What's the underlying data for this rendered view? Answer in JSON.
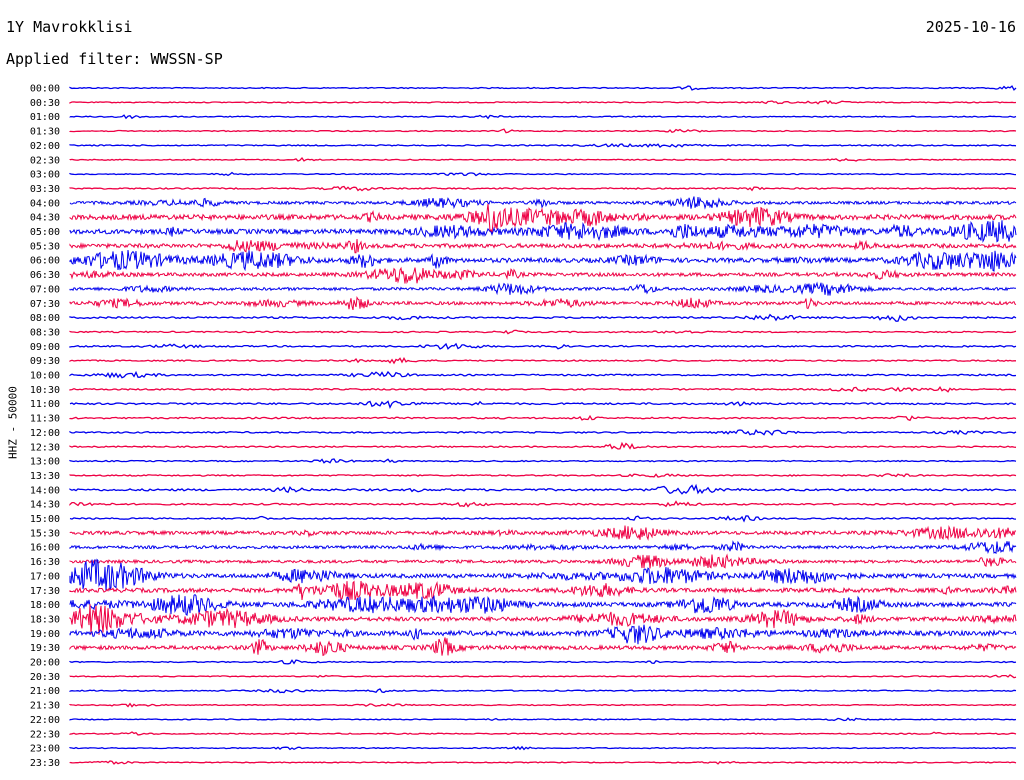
{
  "header": {
    "station": "1Y Mavrokklisi",
    "date": "2025-10-16",
    "filter": "Applied filter: WWSSN-SP"
  },
  "axis": {
    "ylabel": "HHZ - 50000"
  },
  "chart_data": {
    "type": "line",
    "colors": {
      "even": "#0000ee",
      "odd": "#ee0044"
    },
    "rows": [
      {
        "label": "00:00",
        "activity": 0.05
      },
      {
        "label": "00:30",
        "activity": 0.03
      },
      {
        "label": "01:00",
        "activity": 0.03
      },
      {
        "label": "01:30",
        "activity": 0.04
      },
      {
        "label": "02:00",
        "activity": 0.06
      },
      {
        "label": "02:30",
        "activity": 0.03
      },
      {
        "label": "03:00",
        "activity": 0.03
      },
      {
        "label": "03:30",
        "activity": 0.08
      },
      {
        "label": "04:00",
        "activity": 0.35
      },
      {
        "label": "04:30",
        "activity": 0.7
      },
      {
        "label": "05:00",
        "activity": 0.65
      },
      {
        "label": "05:30",
        "activity": 0.55
      },
      {
        "label": "06:00",
        "activity": 0.6
      },
      {
        "label": "06:30",
        "activity": 0.45
      },
      {
        "label": "07:00",
        "activity": 0.35
      },
      {
        "label": "07:30",
        "activity": 0.4
      },
      {
        "label": "08:00",
        "activity": 0.15
      },
      {
        "label": "08:30",
        "activity": 0.08
      },
      {
        "label": "09:00",
        "activity": 0.12
      },
      {
        "label": "09:30",
        "activity": 0.08
      },
      {
        "label": "10:00",
        "activity": 0.12
      },
      {
        "label": "10:30",
        "activity": 0.1
      },
      {
        "label": "11:00",
        "activity": 0.15
      },
      {
        "label": "11:30",
        "activity": 0.12
      },
      {
        "label": "12:00",
        "activity": 0.1
      },
      {
        "label": "12:30",
        "activity": 0.08
      },
      {
        "label": "13:00",
        "activity": 0.06
      },
      {
        "label": "13:30",
        "activity": 0.08
      },
      {
        "label": "14:00",
        "activity": 0.2
      },
      {
        "label": "14:30",
        "activity": 0.12
      },
      {
        "label": "15:00",
        "activity": 0.1
      },
      {
        "label": "15:30",
        "activity": 0.45
      },
      {
        "label": "16:00",
        "activity": 0.35
      },
      {
        "label": "16:30",
        "activity": 0.35
      },
      {
        "label": "17:00",
        "activity": 0.55
      },
      {
        "label": "17:30",
        "activity": 0.55
      },
      {
        "label": "18:00",
        "activity": 0.6
      },
      {
        "label": "18:30",
        "activity": 0.55
      },
      {
        "label": "19:00",
        "activity": 0.65
      },
      {
        "label": "19:30",
        "activity": 0.5
      },
      {
        "label": "20:00",
        "activity": 0.04
      },
      {
        "label": "20:30",
        "activity": 0.02
      },
      {
        "label": "21:00",
        "activity": 0.05
      },
      {
        "label": "21:30",
        "activity": 0.02
      },
      {
        "label": "22:00",
        "activity": 0.02
      },
      {
        "label": "22:30",
        "activity": 0.04
      },
      {
        "label": "23:00",
        "activity": 0.02
      },
      {
        "label": "23:30",
        "activity": 0.02
      }
    ]
  }
}
